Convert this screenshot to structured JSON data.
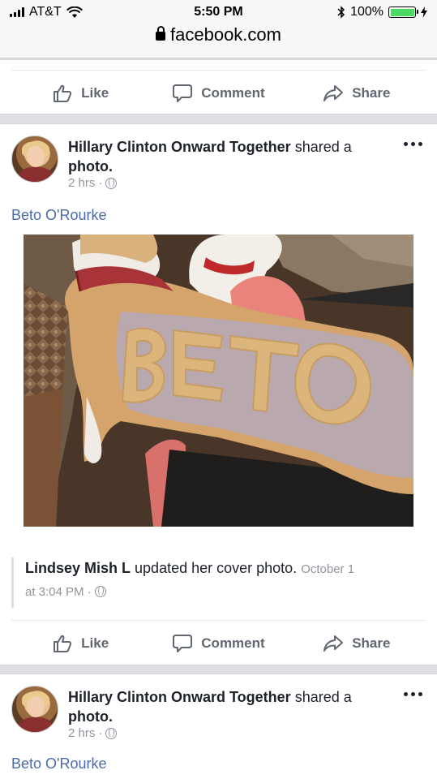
{
  "status": {
    "carrier": "AT&T",
    "time": "5:50 PM",
    "battery": "100%"
  },
  "browser": {
    "url": "facebook.com"
  },
  "actions": {
    "like": "Like",
    "comment": "Comment",
    "share": "Share"
  },
  "post1": {
    "author": "Hillary Clinton Onward Together",
    "verb": " shared a ",
    "object": "photo.",
    "time": "2 hrs",
    "text": "Beto O'Rourke",
    "shared": {
      "author": "Lindsey Mish L",
      "verb": " updated her cover photo. ",
      "date": "October 1",
      "time": "at 3:04 PM"
    }
  },
  "post2": {
    "author": "Hillary Clinton Onward Together",
    "verb": " shared a ",
    "object": "photo.",
    "time": "2 hrs",
    "text": "Beto O'Rourke"
  }
}
